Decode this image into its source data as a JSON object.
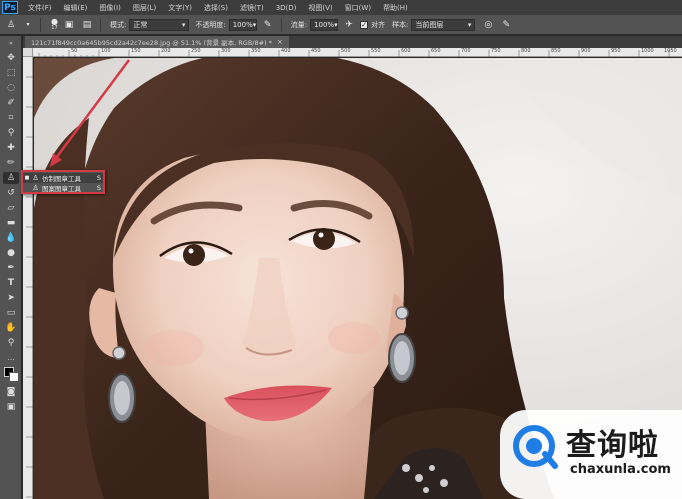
{
  "app": {
    "logo": "Ps",
    "menu": [
      "文件(F)",
      "编辑(E)",
      "图像(I)",
      "图层(L)",
      "文字(Y)",
      "选择(S)",
      "滤镜(T)",
      "3D(D)",
      "视图(V)",
      "窗口(W)",
      "帮助(H)"
    ]
  },
  "options_bar": {
    "brush_size": "17",
    "mode_label": "模式:",
    "mode_value": "正常",
    "opacity_label": "不透明度:",
    "opacity_value": "100%",
    "flow_label": "流量:",
    "flow_value": "100%",
    "aligned_label": "对齐",
    "sample_label": "样本:",
    "sample_value": "当前图层"
  },
  "document": {
    "tab_title": "121c71f849cc0a645b95cd2a42c7ee28.jpg @ 51.1% (背景 副本, RGB/8#) *",
    "close_glyph": "×"
  },
  "ruler": {
    "top_marks": [
      "50",
      "100",
      "150",
      "200",
      "250",
      "300",
      "350",
      "400",
      "450",
      "500",
      "550",
      "600",
      "650",
      "700",
      "750",
      "800",
      "850",
      "900",
      "950",
      "1000",
      "1050",
      "1100"
    ]
  },
  "flyout": {
    "items": [
      {
        "label": "仿制图章工具",
        "shortcut": "S",
        "active": true
      },
      {
        "label": "图案图章工具",
        "shortcut": "S",
        "active": false
      }
    ]
  },
  "watermark": {
    "title": "查询啦",
    "url": "chaxunla.com"
  },
  "colors": {
    "accent_red": "#d23a46",
    "ps_blue": "#31a8ff",
    "watermark_blue": "#1f7de6"
  }
}
